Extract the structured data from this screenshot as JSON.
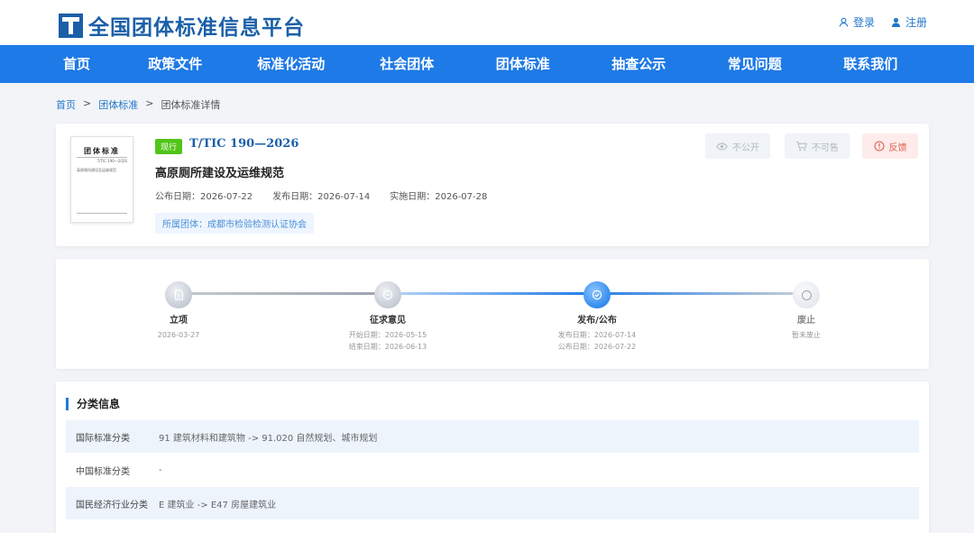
{
  "header": {
    "site_title": "全国团体标准信息平台",
    "login": "登录",
    "register": "注册"
  },
  "nav": [
    "首页",
    "政策文件",
    "标准化活动",
    "社会团体",
    "团体标准",
    "抽查公示",
    "常见问题",
    "联系我们"
  ],
  "breadcrumb": {
    "home": "首页",
    "sep": ">",
    "section": "团体标准",
    "current": "团体标准详情"
  },
  "standard": {
    "status": "现行",
    "code": "T/TIC 190—2026",
    "name": "高原厕所建设及运维规范",
    "publish_label": "公布日期：",
    "publish_date": "2026-07-22",
    "release_label": "发布日期：",
    "release_date": "2026-07-14",
    "effective_label": "实施日期：",
    "effective_date": "2026-07-28",
    "org": "所属团体：成都市检验检测认证协会",
    "thumb_title": "团体标准",
    "thumb_code": "T/TIC 190—2026",
    "thumb_name": "高原厕所建设及运维规范",
    "actions": {
      "private": "不公开",
      "buy": "不可售",
      "feedback": "反馈"
    }
  },
  "timeline": [
    {
      "label": "立项",
      "lines": [
        "2026-03-27"
      ]
    },
    {
      "label": "征求意见",
      "lines": [
        "开始日期：2026-05-15",
        "结束日期：2026-06-13"
      ]
    },
    {
      "label": "发布/公布",
      "lines": [
        "发布日期：2026-07-14",
        "公布日期：2026-07-22"
      ]
    },
    {
      "label": "废止",
      "lines": [
        "暂未废止"
      ]
    }
  ],
  "classification": {
    "title": "分类信息",
    "rows": [
      {
        "key": "国际标准分类",
        "value": "91 建筑材料和建筑物 -> 91.020 自然规划、城市规划"
      },
      {
        "key": "中国标准分类",
        "value": "-"
      },
      {
        "key": "国民经济行业分类",
        "value": "E 建筑业 -> E47 房屋建筑业"
      }
    ]
  },
  "colors": {
    "brand": "#1b5fa8",
    "nav": "#1e7ae6",
    "status_green": "#52c41a",
    "feedback_red": "#e0604f"
  }
}
